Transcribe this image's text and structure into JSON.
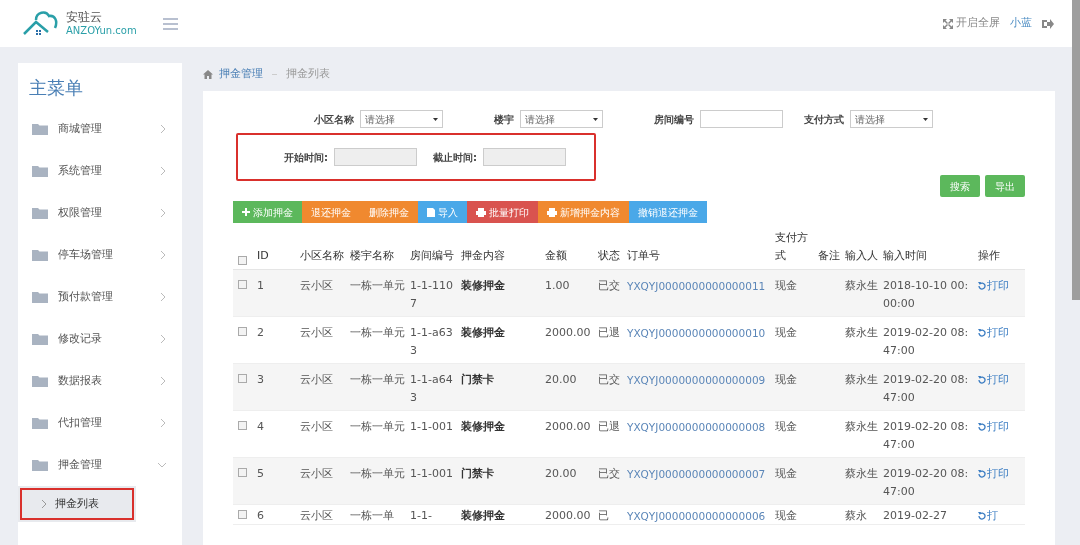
{
  "header": {
    "logo_text": "安驻云",
    "logo_domain": "ANZOYun.com",
    "fullscreen": "开启全屏",
    "user": "小蓝"
  },
  "sidebar": {
    "title": "主菜单",
    "items": [
      {
        "label": "商城管理",
        "expanded": false
      },
      {
        "label": "系统管理",
        "expanded": false
      },
      {
        "label": "权限管理",
        "expanded": false
      },
      {
        "label": "停车场管理",
        "expanded": false
      },
      {
        "label": "预付款管理",
        "expanded": false
      },
      {
        "label": "修改记录",
        "expanded": false
      },
      {
        "label": "数据报表",
        "expanded": false
      },
      {
        "label": "代扣管理",
        "expanded": false
      },
      {
        "label": "押金管理",
        "expanded": true,
        "children": [
          {
            "label": "押金列表",
            "selected": true,
            "highlighted": true
          }
        ]
      }
    ]
  },
  "breadcrumb": [
    "押金管理",
    "押金列表"
  ],
  "filters": {
    "row1": [
      {
        "label": "小区名称",
        "kind": "select",
        "placeholder": "请选择"
      },
      {
        "label": "楼宇",
        "kind": "select",
        "placeholder": "请选择"
      },
      {
        "label": "房间编号",
        "kind": "input"
      },
      {
        "label": "支付方式",
        "kind": "select",
        "placeholder": "请选择"
      }
    ],
    "row2": {
      "highlighted": true,
      "fields": [
        {
          "label": "开始时间:",
          "kind": "date"
        },
        {
          "label": "截止时间:",
          "kind": "date"
        }
      ]
    },
    "buttons": [
      "搜索",
      "导出"
    ]
  },
  "toolbar": [
    {
      "label": "添加押金",
      "kind": "add",
      "color": "#5cb85c"
    },
    {
      "label": "退还押金",
      "kind": "plain",
      "color": "#f0892f"
    },
    {
      "label": "删除押金",
      "kind": "plain",
      "color": "#f0892f"
    },
    {
      "label": "导入",
      "kind": "import",
      "color": "#4aa8e8"
    },
    {
      "label": "批量打印",
      "kind": "print",
      "color": "#d9534f"
    },
    {
      "label": "新增押金内容",
      "kind": "print",
      "color": "#f0892f"
    },
    {
      "label": "撤销退还押金",
      "kind": "plain",
      "color": "#4aa8e8"
    }
  ],
  "table": {
    "all_checked": false,
    "columns": [
      "ID",
      "小区名称",
      "楼宇名称",
      "房间编号",
      "押金内容",
      "金额",
      "状态",
      "订单号",
      "支付方式",
      "备注",
      "输入人",
      "输入时间",
      "操作"
    ],
    "rows": [
      {
        "checked": false,
        "cells": [
          "1",
          "云小区",
          "一栋一单元",
          "1-1-1107",
          "装修押金",
          "1.00",
          "已交",
          "YXQYJ0000000000000011",
          "现金",
          "",
          "蔡永生",
          "2018-10-10 00:00:00",
          "打印"
        ]
      },
      {
        "checked": false,
        "cells": [
          "2",
          "云小区",
          "一栋一单元",
          "1-1-a633",
          "装修押金",
          "2000.00",
          "已退",
          "YXQYJ0000000000000010",
          "现金",
          "",
          "蔡永生",
          "2019-02-20 08:47:00",
          "打印"
        ]
      },
      {
        "checked": false,
        "cells": [
          "3",
          "云小区",
          "一栋一单元",
          "1-1-a643",
          "门禁卡",
          "20.00",
          "已交",
          "YXQYJ0000000000000009",
          "现金",
          "",
          "蔡永生",
          "2019-02-20 08:47:00",
          "打印"
        ]
      },
      {
        "checked": false,
        "cells": [
          "4",
          "云小区",
          "一栋一单元",
          "1-1-001",
          "装修押金",
          "2000.00",
          "已退",
          "YXQYJ0000000000000008",
          "现金",
          "",
          "蔡永生",
          "2019-02-20 08:47:00",
          "打印"
        ]
      },
      {
        "checked": false,
        "cells": [
          "5",
          "云小区",
          "一栋一单元",
          "1-1-001",
          "门禁卡",
          "20.00",
          "已交",
          "YXQYJ0000000000000007",
          "现金",
          "",
          "蔡永生",
          "2019-02-20 08:47:00",
          "打印"
        ]
      },
      {
        "checked": false,
        "cells": [
          "6",
          "云小区",
          "一栋一单",
          "1-1-",
          "装修押金",
          "2000.00",
          "已",
          "YXQYJ0000000000000006",
          "现金",
          "",
          "蔡永",
          "2019-02-27",
          "打"
        ]
      }
    ]
  }
}
